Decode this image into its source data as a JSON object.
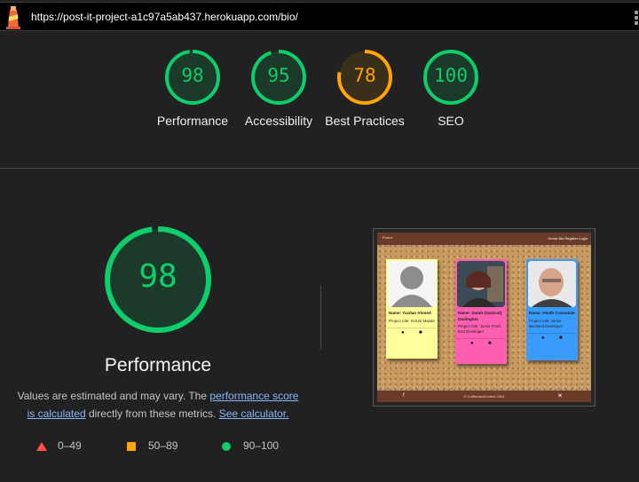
{
  "url_bar": {
    "url": "https://post-it-project-a1c97a5ab437.herokuapp.com/bio/"
  },
  "icons": {
    "logo": "lighthouse-icon",
    "menu": "kebab-menu-icon"
  },
  "colors": {
    "pass": "#0cce6b",
    "average": "#ffa400",
    "fail": "#ff4e42"
  },
  "scores": [
    {
      "label": "Performance",
      "value": "98",
      "level": "pass"
    },
    {
      "label": "Accessibility",
      "value": "95",
      "level": "pass"
    },
    {
      "label": "Best Practices",
      "value": "78",
      "level": "average"
    },
    {
      "label": "SEO",
      "value": "100",
      "level": "pass"
    }
  ],
  "detail": {
    "score": "98",
    "title": "Performance",
    "desc_prefix": "Values are estimated and may vary. The",
    "desc_link": "performance score is calculated",
    "desc_middle": "directly from these metrics.",
    "desc_link2": "See calculator."
  },
  "legend": [
    {
      "range": "0–49",
      "shape": "triangle"
    },
    {
      "range": "50–89",
      "shape": "square"
    },
    {
      "range": "90–100",
      "shape": "circle"
    }
  ],
  "thumbnail": {
    "brand": "Post-it",
    "nav_links": "Home   Bio   Register   Login",
    "footer": "© CoffeeAndCoders 2024",
    "cards": [
      {
        "name": "Name: Yazdan Ahmed",
        "role": "Project role: Scrum Master",
        "bg": "#ffff9b"
      },
      {
        "name": "Name: Sarah (Sazzcat) Darlington",
        "role": "Project role: Junior Front End Developer",
        "bg": "#ff5fb0"
      },
      {
        "name": "Name: Heath Croasdale",
        "role": "Project role: Junior Backend Developer",
        "bg": "#3a9bff"
      }
    ]
  }
}
